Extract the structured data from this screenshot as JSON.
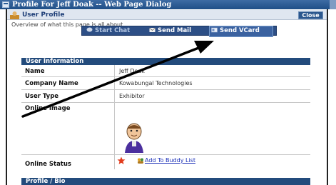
{
  "window": {
    "title": "Profile For Jeff Doak -- Web Page Dialog"
  },
  "header": {
    "title": "User Profile",
    "close_label": "Close"
  },
  "overview_text": "Overview of what this page is all about.",
  "actions": [
    {
      "label": "Start Chat",
      "icon": "chat-icon"
    },
    {
      "label": "Send Mail",
      "icon": "mail-icon"
    },
    {
      "label": "Send VCard",
      "icon": "vcard-icon"
    }
  ],
  "user_info": {
    "heading": "User Information",
    "rows": [
      {
        "label": "Name",
        "value": "Jeff Doak"
      },
      {
        "label": "Company Name",
        "value": "Kowabungal Technologies"
      },
      {
        "label": "User Type",
        "value": "Exhibitor"
      },
      {
        "label": "Online Image",
        "value": ""
      },
      {
        "label": "Online Status",
        "value": ""
      }
    ],
    "buddy_link": "Add To Buddy List"
  },
  "profile_bio": {
    "heading": "Profile / Bio"
  },
  "icons": [
    "window-icon",
    "user-profile-icon",
    "chat-icon",
    "mail-icon",
    "vcard-icon",
    "avatar-image",
    "status-star-icon",
    "buddy-icon",
    "annotation-arrow"
  ],
  "colors": {
    "titlebar": "#2a5d98",
    "section_head": "#234b7c",
    "action_bar": "#2d4f86",
    "link": "#1a2fb8"
  }
}
